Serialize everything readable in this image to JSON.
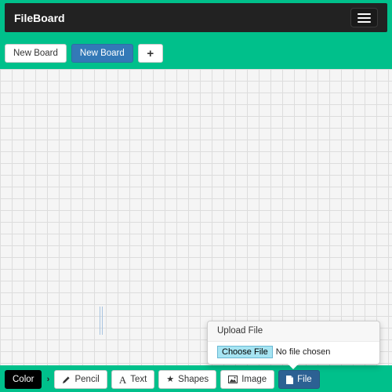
{
  "app": {
    "brand": "FileBoard"
  },
  "boards": {
    "tabs": [
      {
        "label": "New Board",
        "active": false
      },
      {
        "label": "New Board",
        "active": true
      }
    ],
    "add_label": "+"
  },
  "upload": {
    "title": "Upload File",
    "choose_label": "Choose File",
    "status": "No file chosen"
  },
  "toolbar": {
    "color_label": "Color",
    "chevron": "›",
    "pencil_label": "Pencil",
    "text_label": "Text",
    "shapes_label": "Shapes",
    "image_label": "Image",
    "file_label": "File"
  },
  "icons": {
    "pencil": "pencil-icon",
    "text": "font-icon",
    "shapes": "star-icon",
    "image": "picture-icon",
    "file": "file-icon",
    "menu": "hamburger-icon",
    "add": "plus-icon"
  },
  "colors": {
    "accent": "#00c08b",
    "navbar": "#222222",
    "primary": "#3379b7",
    "file_active": "#2c6193"
  }
}
